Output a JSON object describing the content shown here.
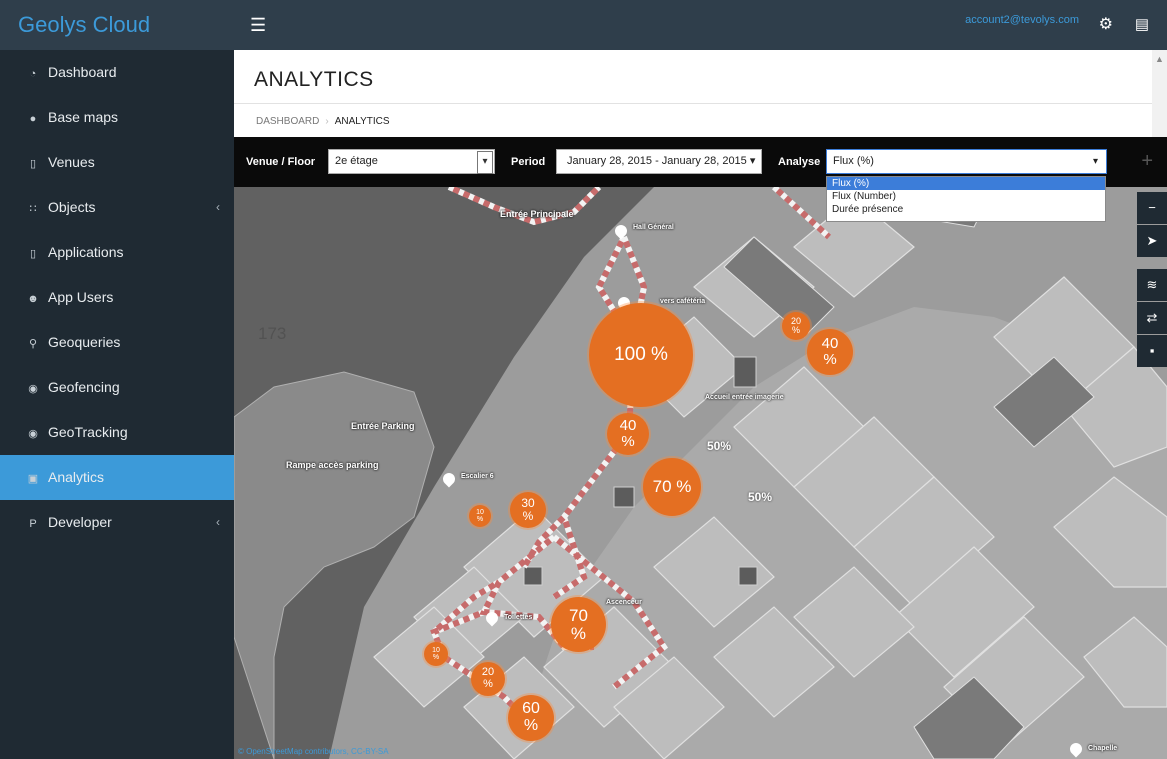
{
  "app": {
    "brand": "Geolys Cloud",
    "account": "account2@tevolys.com"
  },
  "sidebar": {
    "items": [
      {
        "label": "Dashboard",
        "icon": "dashboard-icon",
        "glyph": "◔"
      },
      {
        "label": "Base maps",
        "icon": "globe-icon",
        "glyph": "●"
      },
      {
        "label": "Venues",
        "icon": "building-icon",
        "glyph": "▯"
      },
      {
        "label": "Objects",
        "icon": "signal-icon",
        "glyph": "∷",
        "chevron": "‹"
      },
      {
        "label": "Applications",
        "icon": "mobile-icon",
        "glyph": "▯"
      },
      {
        "label": "App Users",
        "icon": "users-icon",
        "glyph": "☻"
      },
      {
        "label": "Geoqueries",
        "icon": "search-icon",
        "glyph": "⚲"
      },
      {
        "label": "Geofencing",
        "icon": "target-icon",
        "glyph": "◉"
      },
      {
        "label": "GeoTracking",
        "icon": "eye-icon",
        "glyph": "◉"
      },
      {
        "label": "Analytics",
        "icon": "chart-icon",
        "glyph": "▣",
        "active": true
      },
      {
        "label": "Developer",
        "icon": "code-icon",
        "glyph": "P",
        "chevron": "‹"
      }
    ]
  },
  "page": {
    "title": "ANALYTICS"
  },
  "breadcrumb": {
    "home": "DASHBOARD",
    "separator": "›",
    "current": "ANALYTICS"
  },
  "filters": {
    "venue_label": "Venue / Floor",
    "venue_value": "2e étage",
    "period_label": "Period",
    "period_value": "January 28, 2015 - January 28, 2015",
    "analyse_label": "Analyse",
    "analyse_value": "Flux (%)",
    "analyse_options": [
      "Flux (%)",
      "Flux (Number)",
      "Durée présence"
    ]
  },
  "map": {
    "labels": {
      "entree_principale": "Entrée Principale",
      "hall_general": "Hall Général",
      "vers_cafeteria": "vers cafétéria",
      "accueil": "Accueil entrée imagerie",
      "entree_parking": "Entrée Parking",
      "rampe": "Rampe accès parking",
      "escalier": "Escalier 6",
      "toilettes": "Toilettes",
      "ascenceur": "Ascenceur",
      "chapelle": "Chapelle",
      "room_173": "173",
      "pct_a": "50%",
      "pct_b": "50%"
    },
    "bubbles": [
      "100 %",
      "40\n%",
      "70 %",
      "40\n%",
      "20\n%",
      "30\n%",
      "10\n%",
      "70\n%",
      "10\n%",
      "20\n%",
      "60\n%"
    ],
    "attribution": "© OpenStreetMap contributors, CC-BY-SA"
  },
  "colors": {
    "accent": "#3c9ad9",
    "bubble": "#e46f22",
    "sidebar": "#1f2a33"
  }
}
